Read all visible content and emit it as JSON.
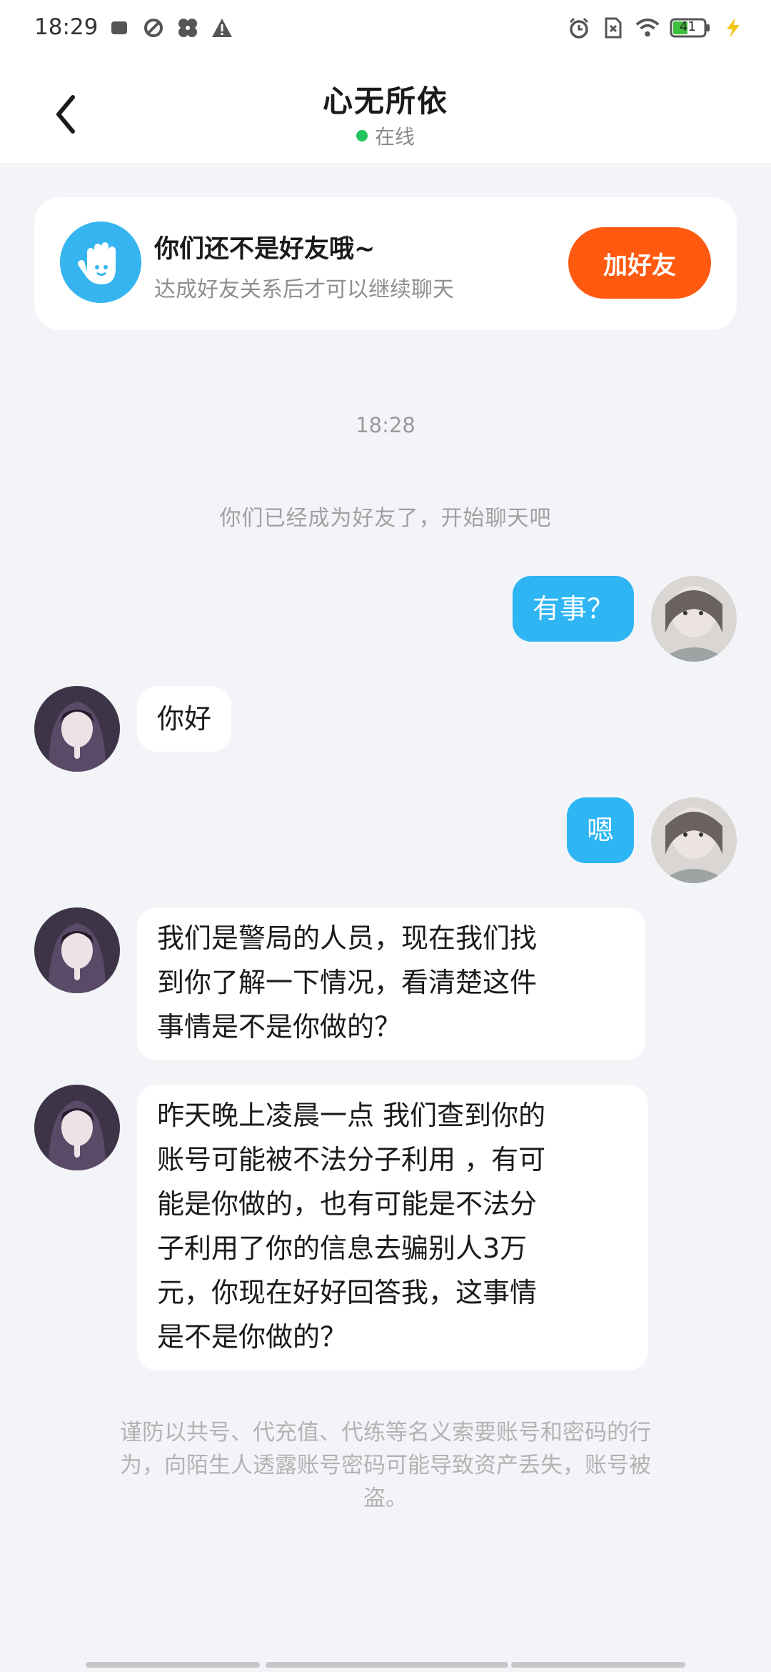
{
  "status_bar": {
    "time": "18:29",
    "battery": "41"
  },
  "header": {
    "title": "心无所依",
    "status": "在线"
  },
  "friend_notice": {
    "title": "你们还不是好友哦~",
    "subtitle": "达成好友关系后才可以继续聊天",
    "button": "加好友"
  },
  "chat": {
    "timestamp": "18:28",
    "system_message": "你们已经成为好友了，开始聊天吧",
    "messages": [
      {
        "side": "out",
        "text": "有事？"
      },
      {
        "side": "in",
        "text": "你好"
      },
      {
        "side": "out",
        "text": "嗯"
      },
      {
        "side": "in",
        "lines": [
          "我们是警局的人员，现在我们找",
          "到你了解一下情况，看清楚这件",
          "事情是不是你做的？"
        ]
      },
      {
        "side": "in",
        "lines": [
          "昨天晚上凌晨一点 我们查到你的",
          "账号可能被不法分子利用 ，有可",
          "能是你做的，也有可能是不法分",
          "子利用了你的信息去骗别人3万",
          "元，你现在好好回答我，这事情",
          "是不是你做的？"
        ]
      }
    ]
  },
  "warning": {
    "lines": [
      "谨防以共号、代充值、代练等名义索要账号和密码的行",
      "为，向陌生人透露账号密码可能导致资产丢失，账号被",
      "盗。"
    ]
  },
  "colors": {
    "accent_blue": "#2eb5f4",
    "add_button": "#ff5a10",
    "online_dot": "#22c55e",
    "background": "#f2f4f8"
  },
  "icons": [
    "notification-icon",
    "sync-icon",
    "fan-icon",
    "warning-icon",
    "alarm-icon",
    "no-sim-icon",
    "wifi-icon",
    "battery-icon",
    "charging-icon",
    "back-arrow-icon",
    "hand-wave-icon"
  ]
}
